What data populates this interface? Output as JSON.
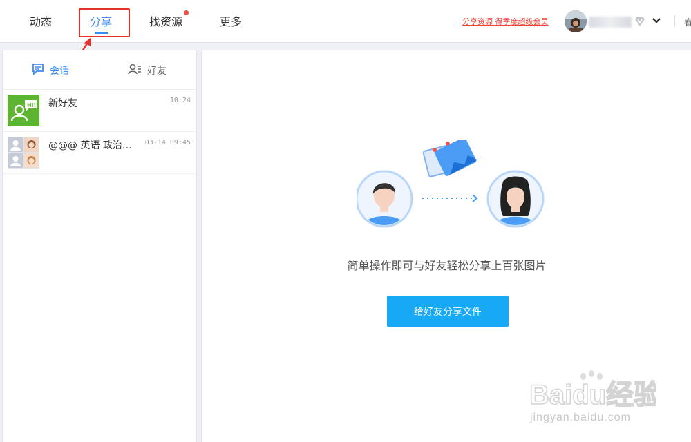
{
  "nav": {
    "items": [
      {
        "label": "动态"
      },
      {
        "label": "分享"
      },
      {
        "label": "找资源"
      },
      {
        "label": "更多"
      }
    ],
    "active_color": "#3b8df0"
  },
  "header": {
    "promo_link": "分享资源 得季度超级会员",
    "cut_text": "春"
  },
  "left_panel": {
    "tabs": [
      {
        "label": "会话",
        "icon": "chat-icon"
      },
      {
        "label": "好友",
        "icon": "contacts-icon"
      }
    ],
    "conversations": [
      {
        "name": "新好友",
        "time": "10:24",
        "icon": "new-friend-icon"
      },
      {
        "name": "@@@ 英语 政治…",
        "time": "03-14 09:45",
        "icon": "group-avatar"
      }
    ]
  },
  "main": {
    "caption": "简单操作即可与好友轻松分享上百张图片",
    "share_button": "给好友分享文件"
  },
  "watermark": {
    "brand": "Baidu经验",
    "url": "jingyan.baidu.com"
  },
  "colors": {
    "accent": "#3b8df0",
    "button": "#18a9f5",
    "highlight": "#e8302a",
    "promo": "#f0443a",
    "new_friend_bg": "#5cb431"
  }
}
